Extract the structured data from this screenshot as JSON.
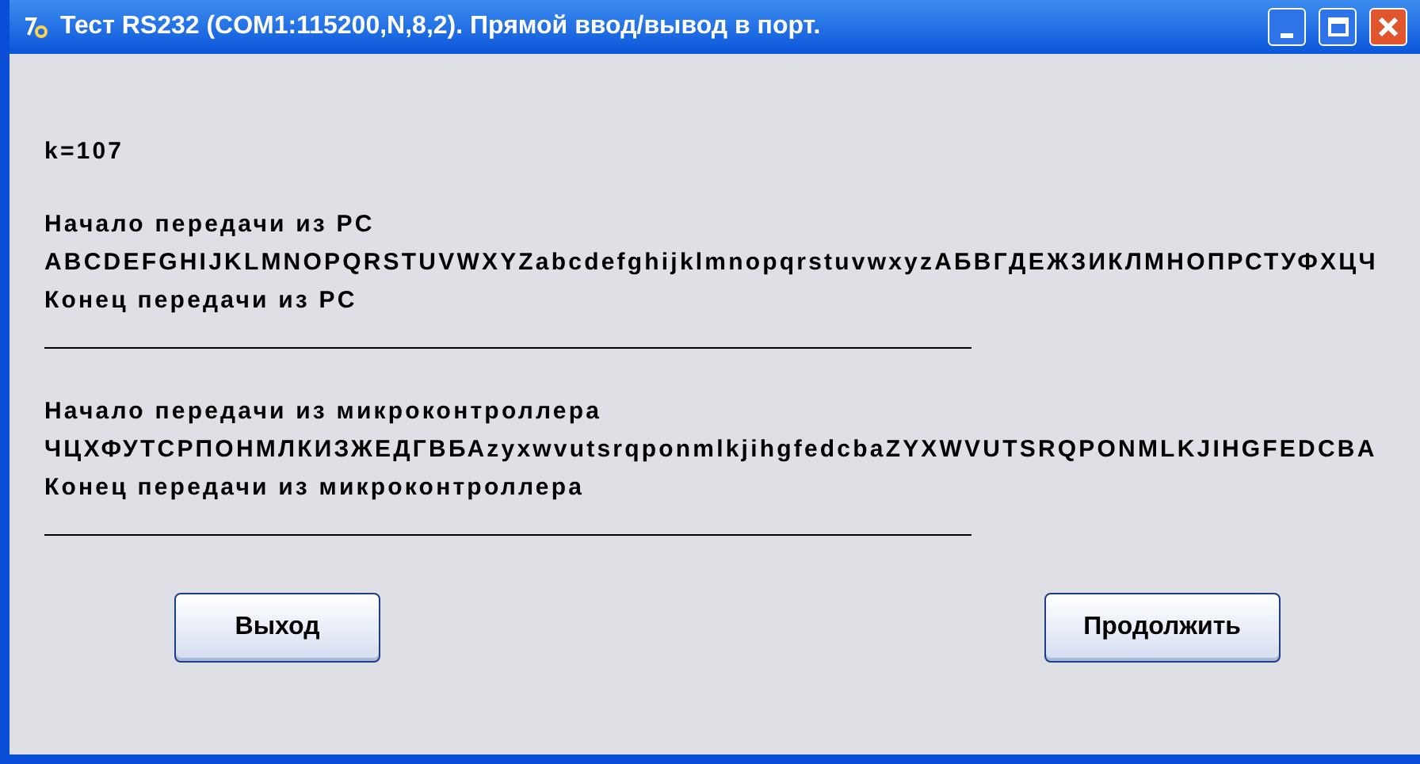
{
  "window": {
    "title": "Тест RS232 (COM1:115200,N,8,2). Прямой ввод/вывод в порт."
  },
  "lines": [
    {
      "kind": "text",
      "text": "k=107"
    },
    {
      "kind": "gap"
    },
    {
      "kind": "text",
      "text": "Начало передачи из PC"
    },
    {
      "kind": "text",
      "text": "ABCDEFGHIJKLMNOPQRSTUVWXYZabcdefghijklmnopqrstuvwxyzАБВГДЕЖЗИКЛМНОПРСТУФХЦЧ"
    },
    {
      "kind": "text",
      "text": "Конец передачи из PC"
    },
    {
      "kind": "rule"
    },
    {
      "kind": "gap"
    },
    {
      "kind": "text",
      "text": "Начало передачи из микроконтроллера"
    },
    {
      "kind": "text",
      "text": "ЧЦХФУТСРПОНМЛКИЗЖЕДГВБАzyxwvutsrqponmlkjihgfedcbaZYXWVUTSRQPONMLKJIHGFEDCBA"
    },
    {
      "kind": "text",
      "text": "Конец передачи из микроконтроллера"
    },
    {
      "kind": "rule"
    }
  ],
  "buttons": [
    "Выход",
    "Продолжить"
  ]
}
